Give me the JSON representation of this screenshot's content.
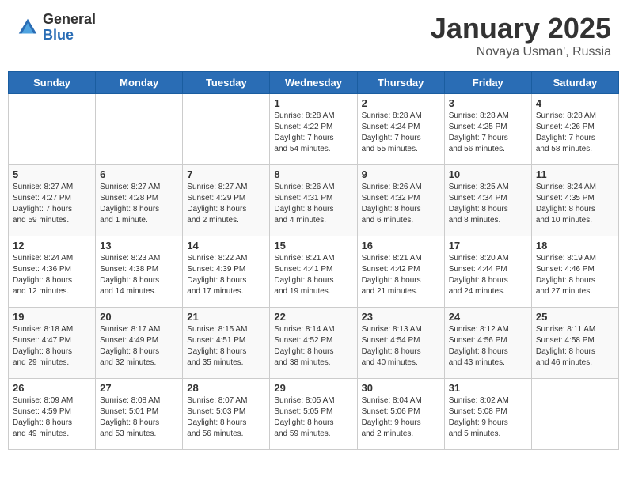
{
  "header": {
    "logo_general": "General",
    "logo_blue": "Blue",
    "title": "January 2025",
    "subtitle": "Novaya Usman', Russia"
  },
  "days_of_week": [
    "Sunday",
    "Monday",
    "Tuesday",
    "Wednesday",
    "Thursday",
    "Friday",
    "Saturday"
  ],
  "weeks": [
    [
      {
        "day": "",
        "info": ""
      },
      {
        "day": "",
        "info": ""
      },
      {
        "day": "",
        "info": ""
      },
      {
        "day": "1",
        "info": "Sunrise: 8:28 AM\nSunset: 4:22 PM\nDaylight: 7 hours\nand 54 minutes."
      },
      {
        "day": "2",
        "info": "Sunrise: 8:28 AM\nSunset: 4:24 PM\nDaylight: 7 hours\nand 55 minutes."
      },
      {
        "day": "3",
        "info": "Sunrise: 8:28 AM\nSunset: 4:25 PM\nDaylight: 7 hours\nand 56 minutes."
      },
      {
        "day": "4",
        "info": "Sunrise: 8:28 AM\nSunset: 4:26 PM\nDaylight: 7 hours\nand 58 minutes."
      }
    ],
    [
      {
        "day": "5",
        "info": "Sunrise: 8:27 AM\nSunset: 4:27 PM\nDaylight: 7 hours\nand 59 minutes."
      },
      {
        "day": "6",
        "info": "Sunrise: 8:27 AM\nSunset: 4:28 PM\nDaylight: 8 hours\nand 1 minute."
      },
      {
        "day": "7",
        "info": "Sunrise: 8:27 AM\nSunset: 4:29 PM\nDaylight: 8 hours\nand 2 minutes."
      },
      {
        "day": "8",
        "info": "Sunrise: 8:26 AM\nSunset: 4:31 PM\nDaylight: 8 hours\nand 4 minutes."
      },
      {
        "day": "9",
        "info": "Sunrise: 8:26 AM\nSunset: 4:32 PM\nDaylight: 8 hours\nand 6 minutes."
      },
      {
        "day": "10",
        "info": "Sunrise: 8:25 AM\nSunset: 4:34 PM\nDaylight: 8 hours\nand 8 minutes."
      },
      {
        "day": "11",
        "info": "Sunrise: 8:24 AM\nSunset: 4:35 PM\nDaylight: 8 hours\nand 10 minutes."
      }
    ],
    [
      {
        "day": "12",
        "info": "Sunrise: 8:24 AM\nSunset: 4:36 PM\nDaylight: 8 hours\nand 12 minutes."
      },
      {
        "day": "13",
        "info": "Sunrise: 8:23 AM\nSunset: 4:38 PM\nDaylight: 8 hours\nand 14 minutes."
      },
      {
        "day": "14",
        "info": "Sunrise: 8:22 AM\nSunset: 4:39 PM\nDaylight: 8 hours\nand 17 minutes."
      },
      {
        "day": "15",
        "info": "Sunrise: 8:21 AM\nSunset: 4:41 PM\nDaylight: 8 hours\nand 19 minutes."
      },
      {
        "day": "16",
        "info": "Sunrise: 8:21 AM\nSunset: 4:42 PM\nDaylight: 8 hours\nand 21 minutes."
      },
      {
        "day": "17",
        "info": "Sunrise: 8:20 AM\nSunset: 4:44 PM\nDaylight: 8 hours\nand 24 minutes."
      },
      {
        "day": "18",
        "info": "Sunrise: 8:19 AM\nSunset: 4:46 PM\nDaylight: 8 hours\nand 27 minutes."
      }
    ],
    [
      {
        "day": "19",
        "info": "Sunrise: 8:18 AM\nSunset: 4:47 PM\nDaylight: 8 hours\nand 29 minutes."
      },
      {
        "day": "20",
        "info": "Sunrise: 8:17 AM\nSunset: 4:49 PM\nDaylight: 8 hours\nand 32 minutes."
      },
      {
        "day": "21",
        "info": "Sunrise: 8:15 AM\nSunset: 4:51 PM\nDaylight: 8 hours\nand 35 minutes."
      },
      {
        "day": "22",
        "info": "Sunrise: 8:14 AM\nSunset: 4:52 PM\nDaylight: 8 hours\nand 38 minutes."
      },
      {
        "day": "23",
        "info": "Sunrise: 8:13 AM\nSunset: 4:54 PM\nDaylight: 8 hours\nand 40 minutes."
      },
      {
        "day": "24",
        "info": "Sunrise: 8:12 AM\nSunset: 4:56 PM\nDaylight: 8 hours\nand 43 minutes."
      },
      {
        "day": "25",
        "info": "Sunrise: 8:11 AM\nSunset: 4:58 PM\nDaylight: 8 hours\nand 46 minutes."
      }
    ],
    [
      {
        "day": "26",
        "info": "Sunrise: 8:09 AM\nSunset: 4:59 PM\nDaylight: 8 hours\nand 49 minutes."
      },
      {
        "day": "27",
        "info": "Sunrise: 8:08 AM\nSunset: 5:01 PM\nDaylight: 8 hours\nand 53 minutes."
      },
      {
        "day": "28",
        "info": "Sunrise: 8:07 AM\nSunset: 5:03 PM\nDaylight: 8 hours\nand 56 minutes."
      },
      {
        "day": "29",
        "info": "Sunrise: 8:05 AM\nSunset: 5:05 PM\nDaylight: 8 hours\nand 59 minutes."
      },
      {
        "day": "30",
        "info": "Sunrise: 8:04 AM\nSunset: 5:06 PM\nDaylight: 9 hours\nand 2 minutes."
      },
      {
        "day": "31",
        "info": "Sunrise: 8:02 AM\nSunset: 5:08 PM\nDaylight: 9 hours\nand 5 minutes."
      },
      {
        "day": "",
        "info": ""
      }
    ]
  ]
}
